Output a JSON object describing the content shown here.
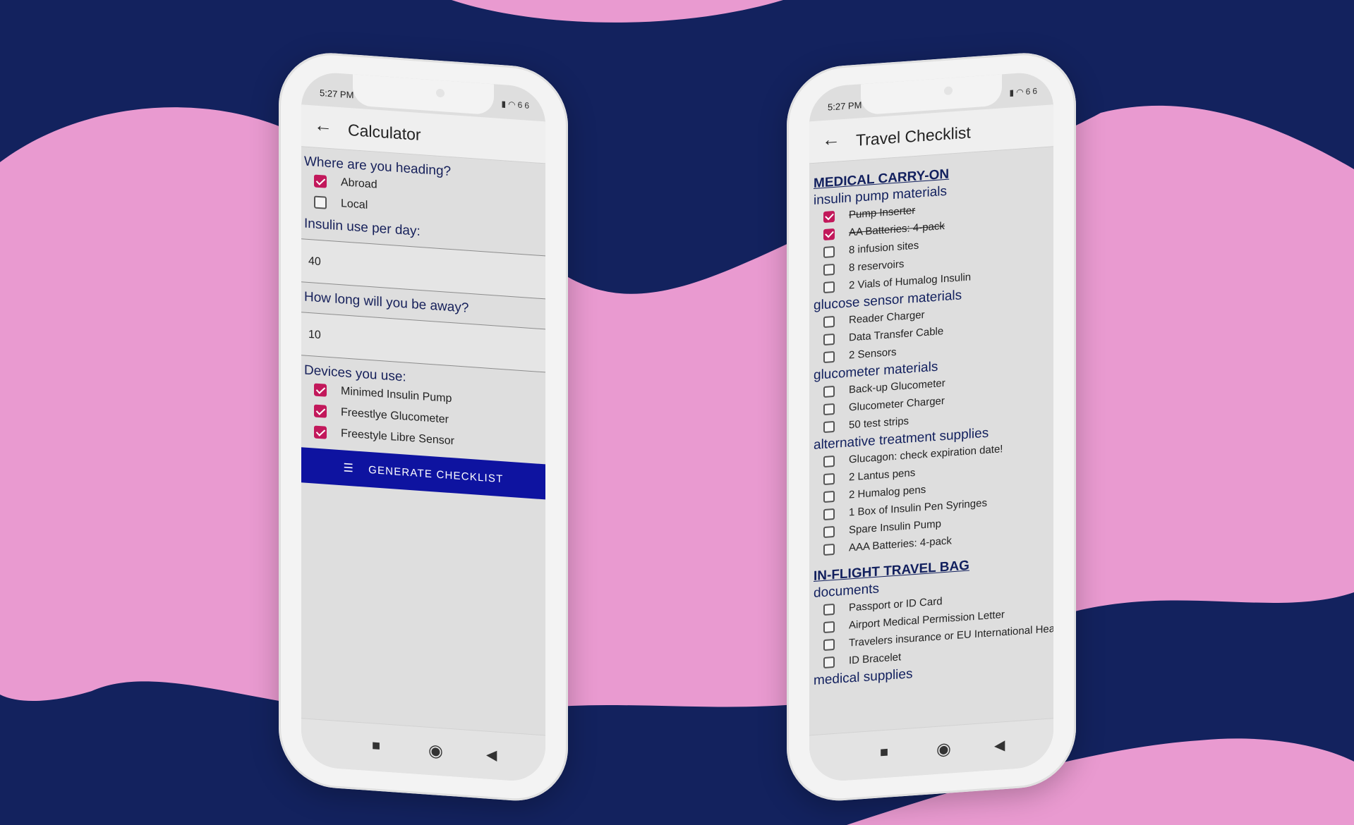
{
  "colors": {
    "background_navy": "#13225e",
    "wave_pink": "#e99ad0",
    "accent_checkbox": "#c2185b",
    "button_blue": "#0e13a0",
    "heading_text": "#12205e"
  },
  "left_phone": {
    "status": {
      "time": "5:27 PM",
      "battery": "66"
    },
    "appbar": {
      "title": "Calculator",
      "back_icon": "arrow-left-icon"
    },
    "heading_q": "Where are you heading?",
    "destinations": [
      {
        "label": "Abroad",
        "checked": true
      },
      {
        "label": "Local",
        "checked": false
      }
    ],
    "insulin_label": "Insulin use per day:",
    "insulin_value": "40",
    "duration_label": "How long will you be away?",
    "duration_value": "10",
    "devices_label": "Devices you use:",
    "devices": [
      {
        "label": "Minimed Insulin Pump",
        "checked": true
      },
      {
        "label": "Freestlye Glucometer",
        "checked": true
      },
      {
        "label": "Freestyle Libre Sensor",
        "checked": true
      }
    ],
    "generate_button": {
      "label": "GENERATE CHECKLIST",
      "icon": "list-icon"
    },
    "nav": {
      "square": "■",
      "home": "◉",
      "back": "◀"
    }
  },
  "right_phone": {
    "status": {
      "time": "5:27 PM",
      "battery": "66"
    },
    "appbar": {
      "title": "Travel Checklist",
      "back_icon": "arrow-left-icon"
    },
    "sections": [
      {
        "title": "MEDICAL CARRY-ON",
        "groups": [
          {
            "name": "insulin pump materials",
            "items": [
              {
                "label": "Pump Inserter",
                "checked": true
              },
              {
                "label": "AA Batteries: 4-pack",
                "checked": true
              },
              {
                "label": "8 infusion sites",
                "checked": false
              },
              {
                "label": "8 reservoirs",
                "checked": false
              },
              {
                "label": "2 Vials of Humalog Insulin",
                "checked": false
              }
            ]
          },
          {
            "name": "glucose sensor materials",
            "items": [
              {
                "label": "Reader Charger",
                "checked": false
              },
              {
                "label": "Data Transfer Cable",
                "checked": false
              },
              {
                "label": "2 Sensors",
                "checked": false
              }
            ]
          },
          {
            "name": "glucometer materials",
            "items": [
              {
                "label": "Back-up Glucometer",
                "checked": false
              },
              {
                "label": "Glucometer Charger",
                "checked": false
              },
              {
                "label": "50 test strips",
                "checked": false
              }
            ]
          },
          {
            "name": "alternative treatment supplies",
            "items": [
              {
                "label": "Glucagon: check expiration date!",
                "checked": false
              },
              {
                "label": "2 Lantus pens",
                "checked": false
              },
              {
                "label": "2 Humalog pens",
                "checked": false
              },
              {
                "label": "1 Box of Insulin Pen Syringes",
                "checked": false
              },
              {
                "label": "Spare Insulin Pump",
                "checked": false
              },
              {
                "label": "AAA Batteries: 4-pack",
                "checked": false
              }
            ]
          }
        ]
      },
      {
        "title": "IN-FLIGHT TRAVEL BAG",
        "groups": [
          {
            "name": "documents",
            "items": [
              {
                "label": "Passport or ID Card",
                "checked": false
              },
              {
                "label": "Airport Medical Permission Letter",
                "checked": false
              },
              {
                "label": "Travelers insurance or EU International Health Car",
                "checked": false
              },
              {
                "label": "ID Bracelet",
                "checked": false
              }
            ]
          },
          {
            "name": "medical supplies",
            "items": []
          }
        ]
      }
    ],
    "nav": {
      "square": "■",
      "home": "◉",
      "back": "◀"
    }
  }
}
